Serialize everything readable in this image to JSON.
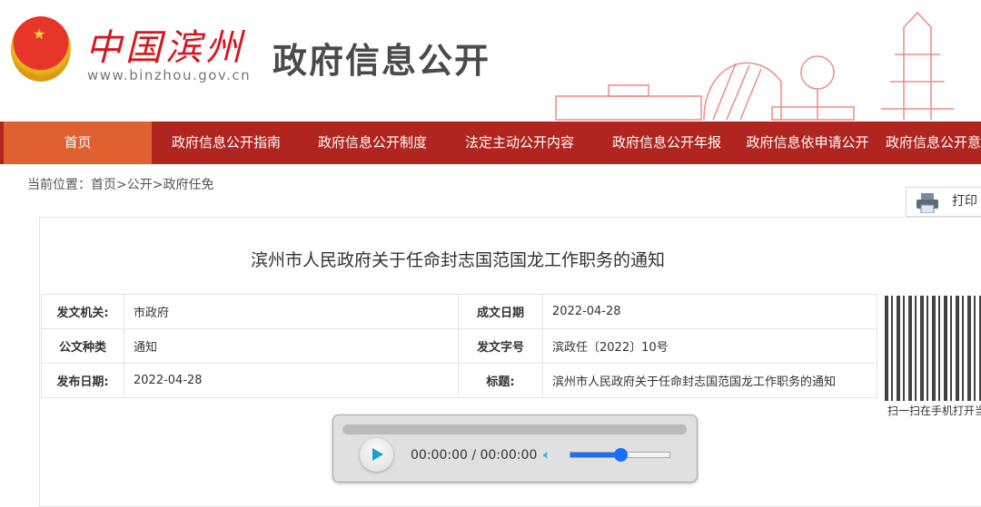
{
  "header": {
    "brand": "中国滨州",
    "url": "www.binzhou.gov.cn",
    "title": "政府信息公开"
  },
  "nav": [
    "首页",
    "政府信息公开指南",
    "政府信息公开制度",
    "法定主动公开内容",
    "政府信息公开年报",
    "政府信息依申请公开",
    "政府信息公开意见箱"
  ],
  "breadcrumb": "当前位置：首页>公开>政府任免",
  "print_label": "打印",
  "document": {
    "title": "滨州市人民政府关于任命封志国范国龙工作职务的通知",
    "meta": [
      {
        "k1": "发文机关:",
        "v1": "市政府",
        "k2": "成文日期",
        "v2": "2022-04-28"
      },
      {
        "k1": "公文种类",
        "v1": "通知",
        "k2": "发文字号",
        "v2": "滨政任〔2022〕10号"
      },
      {
        "k1": "发布日期:",
        "v1": "2022-04-28",
        "k2": "标题:",
        "v2": "滨州市人民政府关于任命封志国范国龙工作职务的通知"
      }
    ],
    "qr_caption": "扫一扫在手机打开当前页"
  },
  "player": {
    "time": "00:00:00 / 00:00:00",
    "progress": 0,
    "volume": 0.5
  },
  "colors": {
    "nav": "#b0251f",
    "nav_active": "#df6132",
    "volume": "#1a6ef7"
  }
}
